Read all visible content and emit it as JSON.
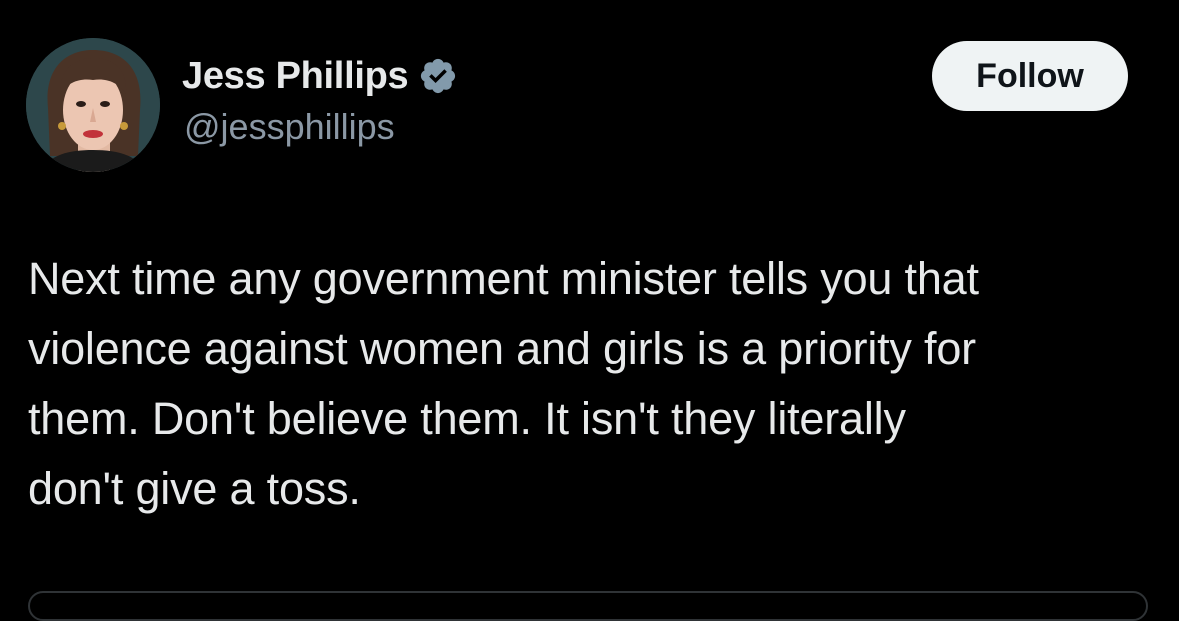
{
  "author": {
    "display_name": "Jess Phillips",
    "handle": "@jessphillips",
    "verified": true,
    "avatar_icon": "profile-photo",
    "badge_icon": "verified-badge-icon"
  },
  "actions": {
    "follow_label": "Follow"
  },
  "tweet": {
    "text": "Next time any government minister tells you that\nviolence against women and girls is a priority for\nthem. Don't believe them. It isn't they literally\ndon't give a toss."
  },
  "colors": {
    "background": "#000000",
    "primary_text": "#e7e9ea",
    "secondary_text": "#8b98a5",
    "follow_button_bg": "#eff3f4",
    "follow_button_text": "#0f1419",
    "verified_badge": "#829aab",
    "border": "#2f3336"
  }
}
